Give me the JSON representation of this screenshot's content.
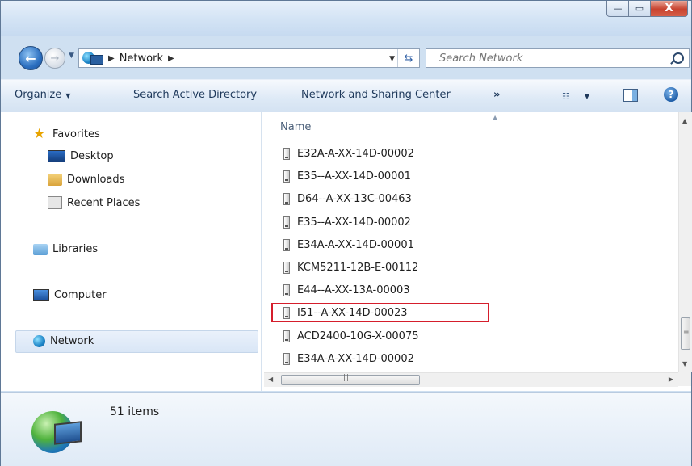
{
  "window": {
    "caption_buttons": {
      "minimize": "—",
      "maximize": "▭",
      "close": "X"
    }
  },
  "navbar": {
    "breadcrumb": [
      "Network"
    ],
    "search_placeholder": "Search Network"
  },
  "toolbar": {
    "organize": "Organize",
    "search_ad": "Search Active Directory",
    "network_sharing": "Network and Sharing Center",
    "more": "»"
  },
  "navpane": {
    "favorites_label": "Favorites",
    "favorites": [
      "Desktop",
      "Downloads",
      "Recent Places"
    ],
    "libraries": "Libraries",
    "computer": "Computer",
    "network": "Network",
    "selected": "Network"
  },
  "filelist": {
    "column_header": "Name",
    "items": [
      "E32A-A-XX-14D-00002",
      "E35--A-XX-14D-00001",
      "D64--A-XX-13C-00463",
      "E35--A-XX-14D-00002",
      "E34A-A-XX-14D-00001",
      "KCM5211-12B-E-00112",
      "E44--A-XX-13A-00003",
      "I51--A-XX-14D-00023",
      "ACD2400-10G-X-00075",
      "E34A-A-XX-14D-00002"
    ],
    "highlighted_item": "I51--A-XX-14D-00023"
  },
  "details": {
    "item_count": "51 items"
  },
  "colors": {
    "highlight_border": "#d51e2c",
    "chrome_blue": "#cfe0f1"
  }
}
